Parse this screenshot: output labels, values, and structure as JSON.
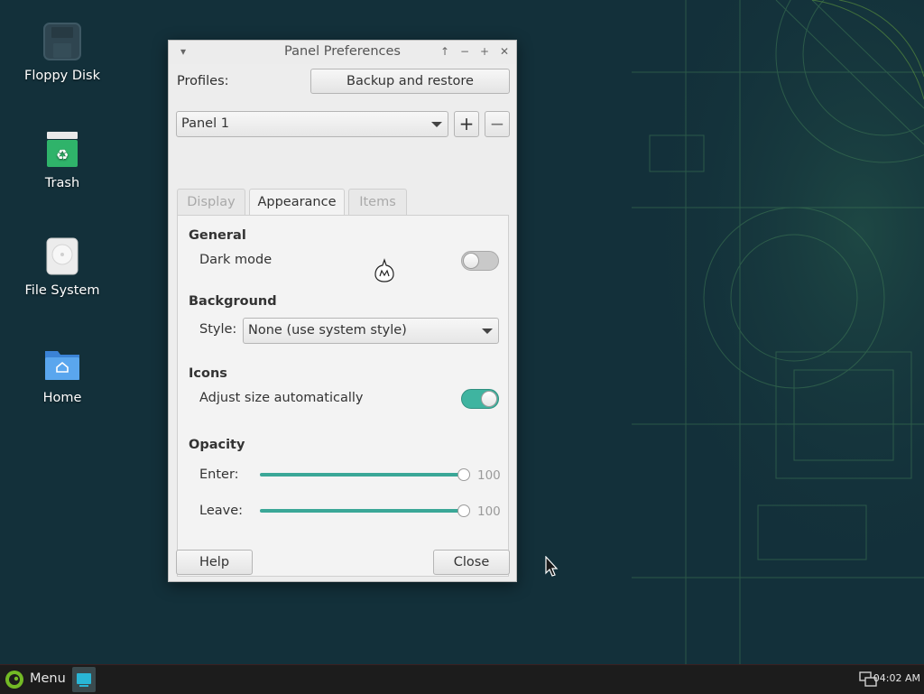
{
  "desktop": {
    "icons": [
      {
        "label": "Floppy Disk",
        "icon": "floppy-disk-icon"
      },
      {
        "label": "Trash",
        "icon": "trash-icon"
      },
      {
        "label": "File System",
        "icon": "drive-icon"
      },
      {
        "label": "Home",
        "icon": "home-folder-icon"
      }
    ]
  },
  "dialog": {
    "title": "Panel Preferences",
    "profiles_label": "Profiles:",
    "backup_button": "Backup and restore",
    "panel_select": {
      "value": "Panel 1"
    },
    "add_symbol": "+",
    "remove_symbol": "−",
    "tabs": [
      {
        "label": "Display",
        "active": false
      },
      {
        "label": "Appearance",
        "active": true
      },
      {
        "label": "Items",
        "active": false
      }
    ],
    "general": {
      "title": "General",
      "dark_mode_label": "Dark mode",
      "dark_mode_on": false
    },
    "background": {
      "title": "Background",
      "style_label": "Style:",
      "style_value": "None (use system style)"
    },
    "icons": {
      "title": "Icons",
      "adjust_label": "Adjust size automatically",
      "adjust_on": true
    },
    "opacity": {
      "title": "Opacity",
      "enter_label": "Enter:",
      "enter_value": "100",
      "leave_label": "Leave:",
      "leave_value": "100"
    },
    "help_button": "Help",
    "close_button": "Close"
  },
  "taskbar": {
    "menu_label": "Menu",
    "clock": "04:02 AM"
  },
  "colors": {
    "accent": "#3fb4a0",
    "desktop_bg": "#13303a",
    "taskbar_bg": "#1c1c1c"
  }
}
